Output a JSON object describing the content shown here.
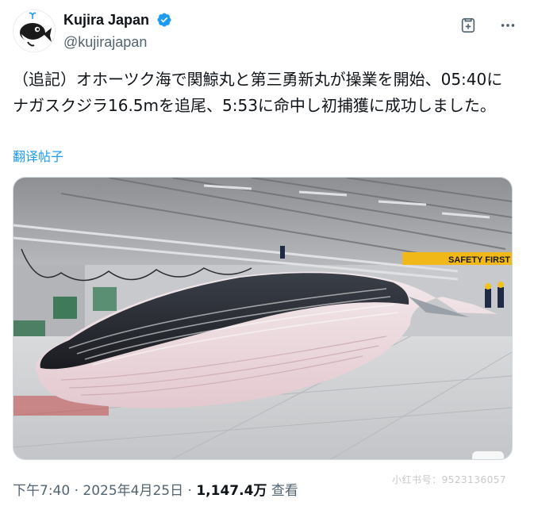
{
  "author": {
    "display_name": "Kujira Japan",
    "handle": "@kujirajapan",
    "verified": true,
    "verified_color": "#1d9bf0"
  },
  "actions": {
    "grok_icon": "grok-icon",
    "more_icon": "more-icon"
  },
  "tweet": {
    "text": "（追記）オホーツク海で関鯨丸と第三勇新丸が操業を開始、05:40にナガスクジラ16.5mを追尾、5:53に命中し初捕獲に成功しました。",
    "translate_label": "翻译帖子"
  },
  "media": {
    "banner_text": "SAFETY FIRST",
    "description_icon": "whale-photo"
  },
  "meta": {
    "time": "下午7:40",
    "date": "2025年4月25日",
    "views_count": "1,147.4万",
    "views_label": "查看"
  },
  "watermark": {
    "text": "小红书号：9523136057"
  }
}
